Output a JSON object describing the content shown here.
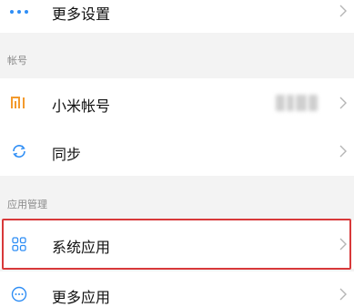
{
  "more_settings": {
    "label": "更多设置",
    "icon": "more-horizontal-icon"
  },
  "account_section": {
    "header": "帐号",
    "mi_account": {
      "label": "小米帐号",
      "icon": "mi-logo-icon"
    },
    "sync": {
      "label": "同步",
      "icon": "sync-icon"
    }
  },
  "app_section": {
    "header": "应用管理",
    "system_apps": {
      "label": "系统应用",
      "icon": "grid-apps-icon"
    },
    "more_apps": {
      "label": "更多应用",
      "icon": "more-circle-icon"
    }
  },
  "colors": {
    "accent_orange": "#f39a2d",
    "accent_blue": "#2f8ef5",
    "highlight_red": "#d8393a"
  }
}
